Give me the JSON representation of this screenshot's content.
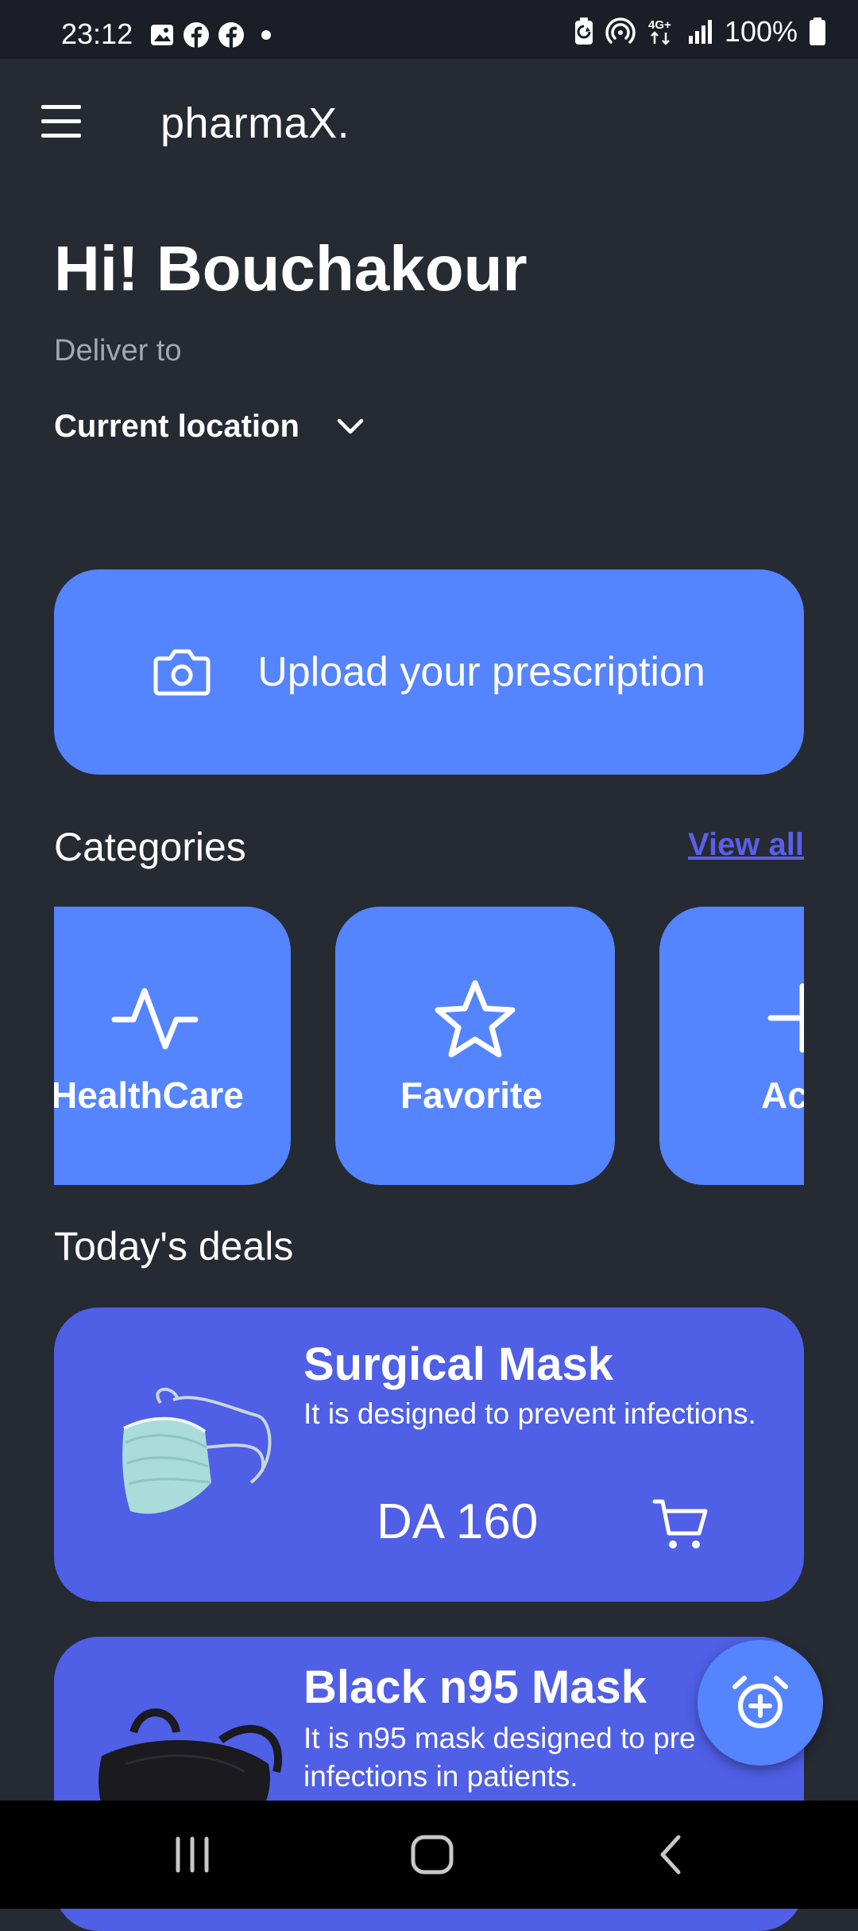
{
  "status_bar": {
    "time": "23:12",
    "battery": "100%",
    "left_icons": [
      "gallery-icon",
      "facebook-icon",
      "facebook-icon",
      "dot-icon"
    ],
    "right_icons": [
      "battery-saver-icon",
      "hotspot-icon",
      "4g-icon",
      "signal-icon",
      "battery-icon"
    ]
  },
  "app_bar": {
    "title": "pharmaX.",
    "menu_icon": "hamburger-menu-icon"
  },
  "header": {
    "greeting": "Hi! Bouchakour",
    "deliver_label": "Deliver to",
    "location": "Current location"
  },
  "upload": {
    "label": "Upload your prescription",
    "icon": "camera-icon"
  },
  "categories": {
    "title": "Categories",
    "view_all": "View all",
    "items": [
      {
        "label": "HealthCare",
        "icon": "heartbeat-icon"
      },
      {
        "label": "Favorite",
        "icon": "star-icon"
      },
      {
        "label": "Ac",
        "icon": "plus-icon"
      }
    ]
  },
  "deals": {
    "title": "Today's deals",
    "items": [
      {
        "name": "Surgical Mask",
        "description": "It is designed to prevent infections.",
        "price": "DA 160",
        "image": "surgical-mask-image"
      },
      {
        "name": "Black n95 Mask",
        "description": "It is n95 mask designed to pre infections in patients.",
        "image": "black-n95-mask-image"
      }
    ]
  },
  "fab": {
    "icon": "add-alarm-icon"
  },
  "nav_bar": {
    "icons": [
      "recent-apps-icon",
      "home-icon",
      "back-icon"
    ]
  },
  "colors": {
    "background": "#262a33",
    "status_bar": "#1b1e26",
    "primary_blue": "#5584ff",
    "deal_card": "#4f5fe6",
    "link": "#5b5fe8"
  }
}
